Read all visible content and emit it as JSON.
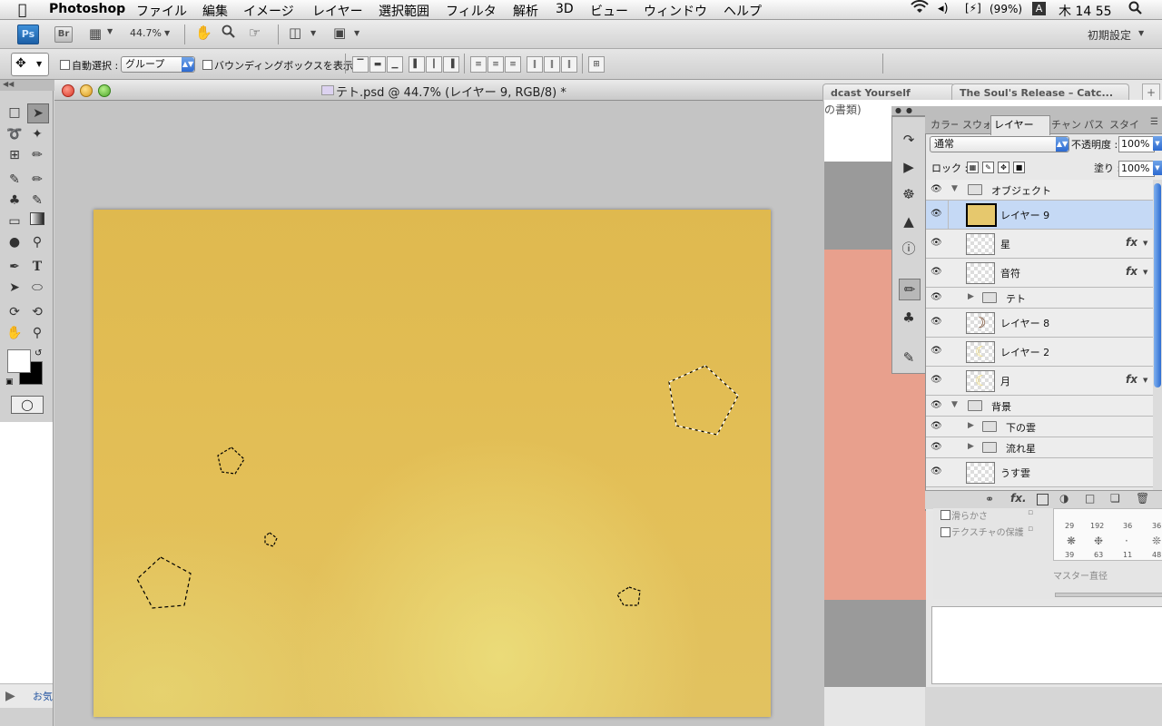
{
  "menubar": {
    "app": "Photoshop",
    "items": [
      "ファイル",
      "編集",
      "イメージ",
      "レイヤー",
      "選択範囲",
      "フィルタ",
      "解析",
      "3D",
      "ビュー",
      "ウィンドウ",
      "ヘルプ"
    ],
    "battery": "(99%)",
    "input_method": "A",
    "clock": "木 14 55"
  },
  "appbar": {
    "ps_logo": "Ps",
    "br_logo": "Br",
    "zoom": "44.7%",
    "workspace": "初期設定"
  },
  "options": {
    "auto_select_label": "自動選択 :",
    "auto_select_value": "グループ",
    "bounding_box_label": "バウンディングボックスを表示"
  },
  "document": {
    "title": "テト.psd @ 44.7% (レイヤー 9, RGB/8) *"
  },
  "browser": {
    "tab1": "dcast Yourself",
    "tab2": "The Soul's Release – Catc...",
    "snippet": "の書類)",
    "link_fragment": "お気"
  },
  "layers_panel": {
    "tabs": [
      "カラー",
      "スウォ",
      "レイヤー",
      "チャン",
      "パス",
      "スタイ"
    ],
    "blend_mode": "通常",
    "opacity_label": "不透明度 :",
    "opacity_value": "100%",
    "lock_label": "ロック :",
    "fill_label": "塗り :",
    "fill_value": "100%",
    "rows": [
      {
        "name": "オブジェクト",
        "kind": "group-open"
      },
      {
        "name": "レイヤー 9",
        "kind": "layer",
        "selected": true
      },
      {
        "name": "星",
        "kind": "layer",
        "fx": "fx"
      },
      {
        "name": "音符",
        "kind": "layer",
        "fx": "fx"
      },
      {
        "name": "テト",
        "kind": "group-closed"
      },
      {
        "name": "レイヤー 8",
        "kind": "layer"
      },
      {
        "name": "レイヤー 2",
        "kind": "layer"
      },
      {
        "name": "月",
        "kind": "layer",
        "fx": "fx"
      },
      {
        "name": "背景",
        "kind": "group-open"
      },
      {
        "name": "下の雲",
        "kind": "group-closed"
      },
      {
        "name": "流れ星",
        "kind": "group-closed"
      },
      {
        "name": "うす雲",
        "kind": "layer"
      }
    ]
  },
  "brush_panel": {
    "smoothing": "滑らかさ",
    "texture_protect": "テクスチャの保護",
    "master_diameter": "マスター直径",
    "sizes": [
      "29",
      "192",
      "36",
      "36",
      "39",
      "63",
      "11",
      "48"
    ]
  },
  "colors": {
    "canvas": "#e1bd56",
    "selection_row": "#c5d9f5",
    "accent_blue": "#2d6ad1"
  }
}
